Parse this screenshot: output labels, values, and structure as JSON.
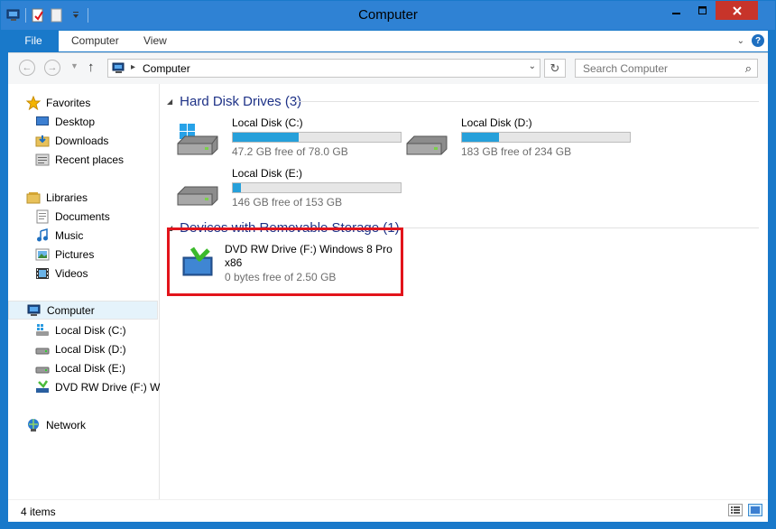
{
  "window": {
    "title": "Computer"
  },
  "ribbon": {
    "tabs": [
      "File",
      "Computer",
      "View"
    ]
  },
  "address": {
    "crumb": "Computer",
    "search_placeholder": "Search Computer"
  },
  "sidebar": {
    "favorites": {
      "label": "Favorites",
      "items": [
        "Desktop",
        "Downloads",
        "Recent places"
      ]
    },
    "libraries": {
      "label": "Libraries",
      "items": [
        "Documents",
        "Music",
        "Pictures",
        "Videos"
      ]
    },
    "computer": {
      "label": "Computer",
      "items": [
        "Local Disk (C:)",
        "Local Disk (D:)",
        "Local Disk (E:)",
        "DVD RW Drive (F:) Wir"
      ]
    },
    "network": {
      "label": "Network"
    }
  },
  "main": {
    "hdd_group": "Hard Disk Drives (3)",
    "drives": [
      {
        "name": "Local Disk (C:)",
        "free": "47.2 GB free of 78.0 GB",
        "used_fraction": 0.395
      },
      {
        "name": "Local Disk (D:)",
        "free": "183 GB free of 234 GB",
        "used_fraction": 0.218
      },
      {
        "name": "Local Disk (E:)",
        "free": "146 GB free of 153 GB",
        "used_fraction": 0.046
      }
    ],
    "removable_group": "Devices with Removable Storage (1)",
    "dvd": {
      "name": "DVD RW Drive (F:) Windows 8 Pro x86",
      "free": "0 bytes free of 2.50 GB"
    }
  },
  "status": {
    "items": "4 items"
  },
  "colors": {
    "accent": "#1979ca",
    "bar_fill": "#26a0da",
    "highlight": "#e2141b",
    "group_header": "#1e3287"
  }
}
